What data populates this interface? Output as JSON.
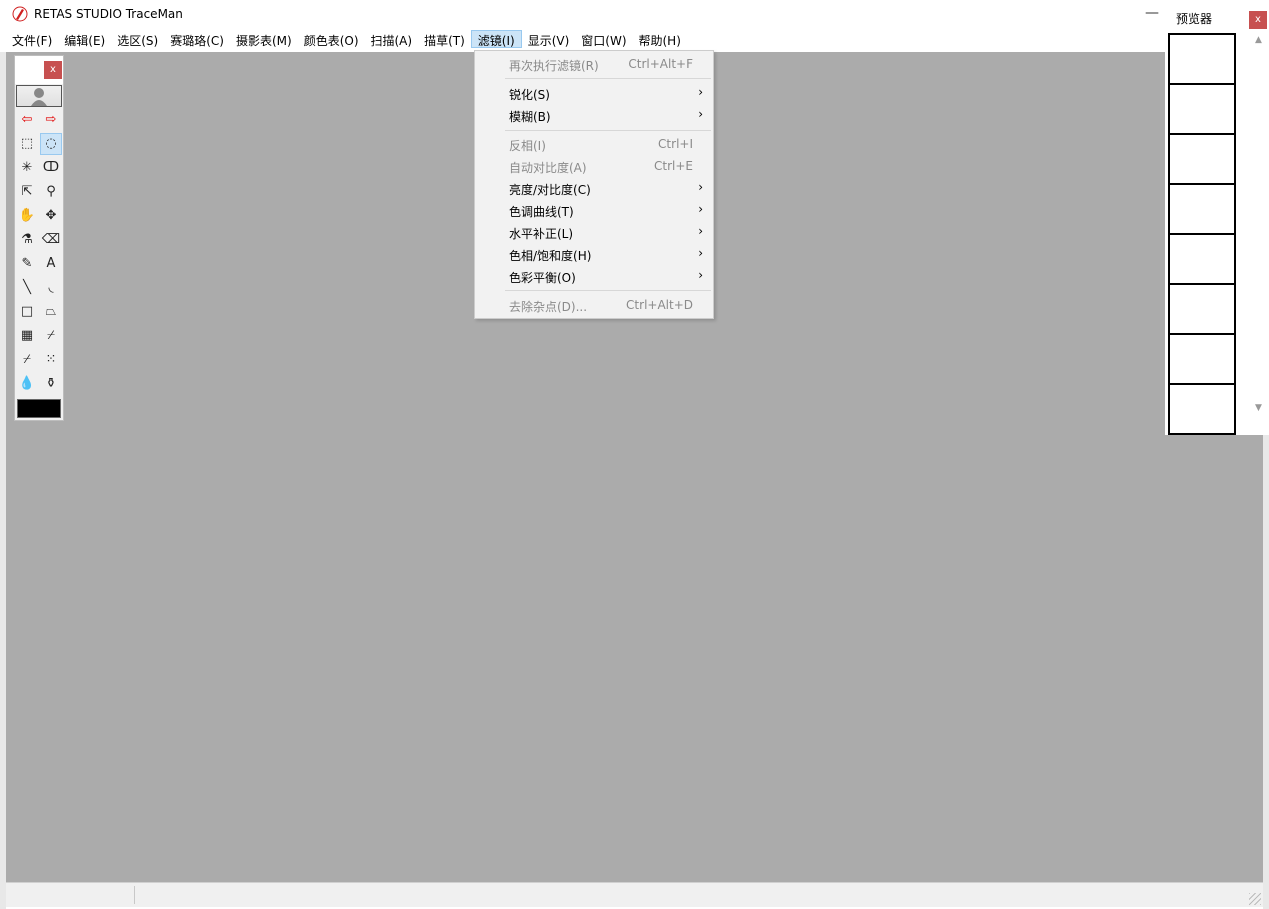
{
  "window": {
    "title": "RETAS STUDIO TraceMan",
    "minimize_glyph": "—"
  },
  "menubar": [
    {
      "label": "文件(F)"
    },
    {
      "label": "编辑(E)"
    },
    {
      "label": "选区(S)"
    },
    {
      "label": "赛璐珞(C)"
    },
    {
      "label": "摄影表(M)"
    },
    {
      "label": "颜色表(O)"
    },
    {
      "label": "扫描(A)"
    },
    {
      "label": "描草(T)"
    },
    {
      "label": "滤镜(I)",
      "active": true
    },
    {
      "label": "显示(V)"
    },
    {
      "label": "窗口(W)"
    },
    {
      "label": "帮助(H)"
    }
  ],
  "filter_menu": {
    "items": [
      {
        "label": "再次执行滤镜(R)",
        "shortcut": "Ctrl+Alt+F",
        "disabled": true
      },
      {
        "label": "锐化(S)",
        "submenu": true
      },
      {
        "label": "模糊(B)",
        "submenu": true
      },
      {
        "label": "反相(I)",
        "shortcut": "Ctrl+I",
        "disabled": true
      },
      {
        "label": "自动对比度(A)",
        "shortcut": "Ctrl+E",
        "disabled": true
      },
      {
        "label": "亮度/对比度(C)",
        "submenu": true
      },
      {
        "label": "色调曲线(T)",
        "submenu": true
      },
      {
        "label": "水平补正(L)",
        "submenu": true
      },
      {
        "label": "色相/饱和度(H)",
        "submenu": true
      },
      {
        "label": "色彩平衡(O)",
        "submenu": true
      },
      {
        "label": "去除杂点(D)...",
        "shortcut": "Ctrl+Alt+D",
        "disabled": true
      }
    ],
    "submenu_glyph": "›"
  },
  "tool_palette": {
    "close_glyph": "x",
    "tools": [
      {
        "icon": "arrow-left-icon",
        "glyph": "⇦",
        "color": "#e00000"
      },
      {
        "icon": "arrow-right-icon",
        "glyph": "⇨",
        "color": "#e00000"
      },
      {
        "icon": "rect-select-icon",
        "glyph": "⬚"
      },
      {
        "icon": "lasso-icon",
        "glyph": "◌",
        "selected": true
      },
      {
        "icon": "magic-wand-icon",
        "glyph": "✳"
      },
      {
        "icon": "lasso-fill-icon",
        "glyph": "ↀ"
      },
      {
        "icon": "pointer-select-icon",
        "glyph": "⇱"
      },
      {
        "icon": "zoom-icon",
        "glyph": "⚲"
      },
      {
        "icon": "hand-icon",
        "glyph": "✋"
      },
      {
        "icon": "move-icon",
        "glyph": "✥"
      },
      {
        "icon": "eyedropper-icon",
        "glyph": "⚗"
      },
      {
        "icon": "eraser-icon",
        "glyph": "⌫"
      },
      {
        "icon": "pencil-icon",
        "glyph": "✎"
      },
      {
        "icon": "text-icon",
        "glyph": "A"
      },
      {
        "icon": "line-icon",
        "glyph": "╲"
      },
      {
        "icon": "curve-icon",
        "glyph": "◟"
      },
      {
        "icon": "rectangle-icon",
        "glyph": "□"
      },
      {
        "icon": "polygon-icon",
        "glyph": "⏢"
      },
      {
        "icon": "gradient-icon",
        "glyph": "▦"
      },
      {
        "icon": "brush-icon",
        "glyph": "⌿"
      },
      {
        "icon": "fill-brush-icon",
        "glyph": "⌿"
      },
      {
        "icon": "airbrush-icon",
        "glyph": "⁙"
      },
      {
        "icon": "drop-icon",
        "glyph": "💧"
      },
      {
        "icon": "ink-bottle-icon",
        "glyph": "⚱"
      }
    ],
    "current_color": "#000000"
  },
  "previewer": {
    "title": "预览器",
    "close_glyph": "x",
    "frames": 8,
    "scroll_up_glyph": "▲",
    "scroll_down_glyph": "▼"
  }
}
